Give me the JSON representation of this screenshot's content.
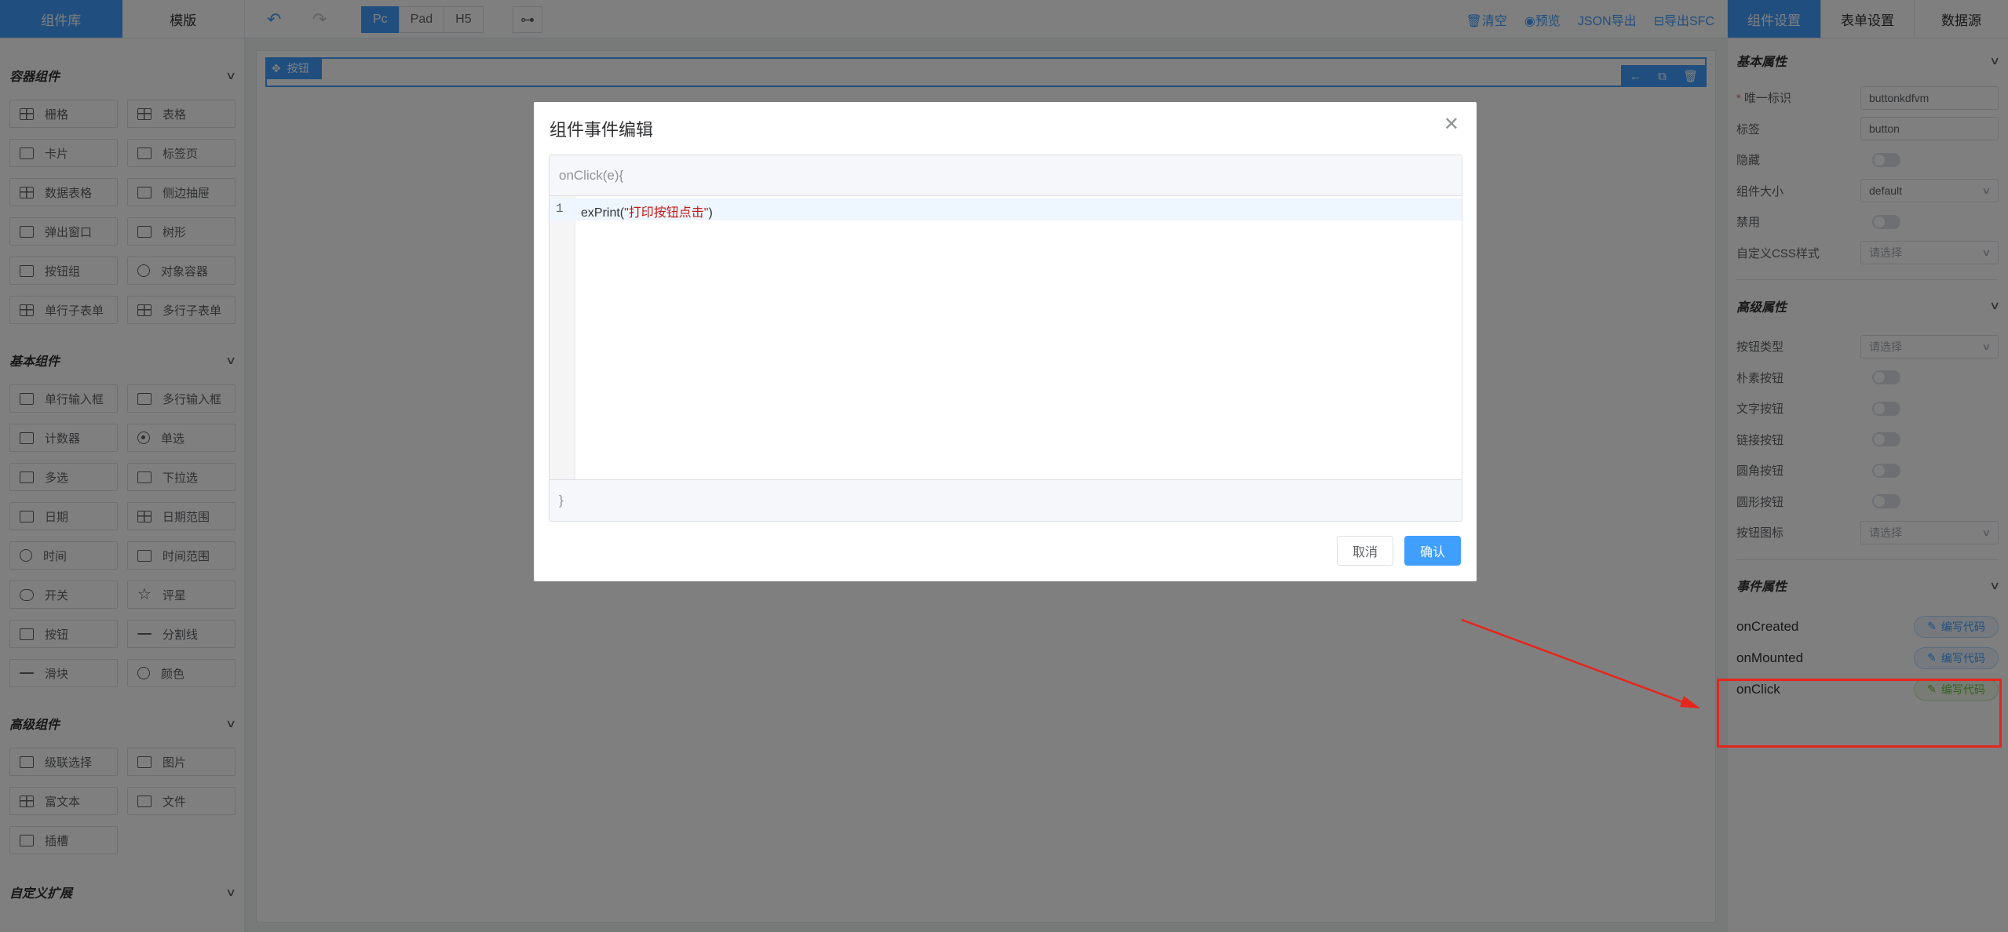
{
  "left_panel": {
    "tabs": [
      "组件库",
      "模版"
    ],
    "categories": [
      {
        "title": "容器组件",
        "items": [
          {
            "label": "栅格",
            "icon": "grid-icon"
          },
          {
            "label": "表格",
            "icon": "table-icon"
          },
          {
            "label": "卡片",
            "icon": "card-icon"
          },
          {
            "label": "标签页",
            "icon": "tabs-icon"
          },
          {
            "label": "数据表格",
            "icon": "data-table-icon"
          },
          {
            "label": "侧边抽屉",
            "icon": "drawer-icon"
          },
          {
            "label": "弹出窗口",
            "icon": "dialog-icon"
          },
          {
            "label": "树形",
            "icon": "tree-icon"
          },
          {
            "label": "按钮组",
            "icon": "button-group-icon"
          },
          {
            "label": "对象容器",
            "icon": "object-container-icon"
          },
          {
            "label": "单行子表单",
            "icon": "single-subform-icon"
          },
          {
            "label": "多行子表单",
            "icon": "multi-subform-icon"
          }
        ]
      },
      {
        "title": "基本组件",
        "items": [
          {
            "label": "单行输入框",
            "icon": "input-icon"
          },
          {
            "label": "多行输入框",
            "icon": "textarea-icon"
          },
          {
            "label": "计数器",
            "icon": "number-icon"
          },
          {
            "label": "单选",
            "icon": "radio-icon"
          },
          {
            "label": "多选",
            "icon": "checkbox-icon"
          },
          {
            "label": "下拉选",
            "icon": "select-icon"
          },
          {
            "label": "日期",
            "icon": "date-icon"
          },
          {
            "label": "日期范围",
            "icon": "date-range-icon"
          },
          {
            "label": "时间",
            "icon": "time-icon"
          },
          {
            "label": "时间范围",
            "icon": "time-range-icon"
          },
          {
            "label": "开关",
            "icon": "switch-icon"
          },
          {
            "label": "评星",
            "icon": "star-icon"
          },
          {
            "label": "按钮",
            "icon": "button-icon"
          },
          {
            "label": "分割线",
            "icon": "divider-icon"
          },
          {
            "label": "滑块",
            "icon": "slider-icon"
          },
          {
            "label": "颜色",
            "icon": "color-icon"
          }
        ]
      },
      {
        "title": "高级组件",
        "items": [
          {
            "label": "级联选择",
            "icon": "cascader-icon"
          },
          {
            "label": "图片",
            "icon": "image-icon"
          },
          {
            "label": "富文本",
            "icon": "rich-text-icon"
          },
          {
            "label": "文件",
            "icon": "folder-icon"
          },
          {
            "label": "插槽",
            "icon": "slot-icon"
          }
        ]
      },
      {
        "title": "自定义扩展",
        "items": []
      }
    ]
  },
  "toolbar": {
    "devices": [
      "Pc",
      "Pad",
      "H5"
    ],
    "active_device": "Pc",
    "actions": [
      "清空",
      "预览",
      "JSON导出",
      "导出SFC"
    ]
  },
  "canvas": {
    "selected_widget_label": "按钮"
  },
  "right_panel": {
    "tabs": [
      "组件设置",
      "表单设置",
      "数据源"
    ],
    "basic": {
      "title": "基本属性",
      "id_label": "唯一标识",
      "id_value": "buttonkdfvm",
      "label_label": "标签",
      "label_value": "button",
      "hidden_label": "隐藏",
      "size_label": "组件大小",
      "size_value": "default",
      "disabled_label": "禁用",
      "css_label": "自定义CSS样式",
      "css_placeholder": "请选择"
    },
    "advanced": {
      "title": "高级属性",
      "type_label": "按钮类型",
      "type_placeholder": "请选择",
      "plain_label": "朴素按钮",
      "text_label": "文字按钮",
      "link_label": "链接按钮",
      "round_label": "圆角按钮",
      "circle_label": "圆形按钮",
      "icon_label": "按钮图标",
      "icon_placeholder": "请选择"
    },
    "events": {
      "title": "事件属性",
      "items": [
        {
          "name": "onCreated",
          "button": "编写代码"
        },
        {
          "name": "onMounted",
          "button": "编写代码"
        },
        {
          "name": "onClick",
          "button": "编写代码"
        }
      ]
    }
  },
  "dialog": {
    "title": "组件事件编辑",
    "code_header": "onClick(e){",
    "line_number": "1",
    "code_fn": "exPrint(",
    "code_str": "\"打印按钮点击\"",
    "code_end": ")",
    "code_footer": "}",
    "cancel": "取消",
    "confirm": "确认"
  },
  "colors": {
    "primary": "#409eff",
    "annotation": "#e6251c",
    "success": "#67c23a"
  }
}
